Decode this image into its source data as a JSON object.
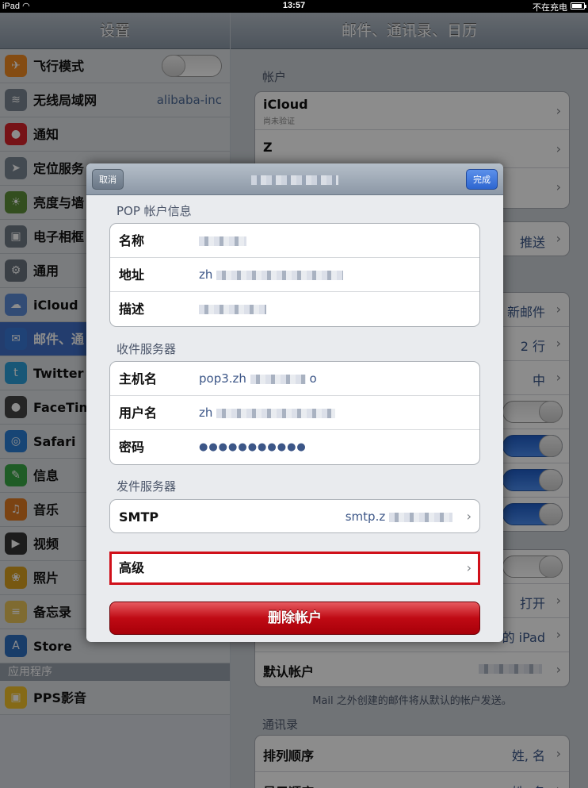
{
  "status_bar": {
    "device": "iPad",
    "time": "13:57",
    "charging": "不在充电"
  },
  "left_pane": {
    "title": "设置",
    "items": [
      {
        "label": "飞行模式",
        "icon": "airplane-icon",
        "toggle": "off"
      },
      {
        "label": "无线局域网",
        "value": "alibaba-inc",
        "icon": "wifi-icon"
      },
      {
        "label": "通知",
        "icon": "notification-icon"
      },
      {
        "label": "定位服务",
        "icon": "location-icon"
      },
      {
        "label": "亮度与墙",
        "icon": "brightness-icon"
      },
      {
        "label": "电子相框",
        "icon": "picture-frame-icon"
      },
      {
        "label": "通用",
        "icon": "gear-icon"
      },
      {
        "label": "iCloud",
        "icon": "cloud-icon"
      },
      {
        "label": "邮件、通",
        "icon": "mail-icon",
        "selected": true
      },
      {
        "label": "Twitter",
        "icon": "twitter-icon"
      },
      {
        "label": "FaceTim",
        "icon": "facetime-icon"
      },
      {
        "label": "Safari",
        "icon": "safari-icon"
      },
      {
        "label": "信息",
        "icon": "messages-icon"
      },
      {
        "label": "音乐",
        "icon": "music-icon"
      },
      {
        "label": "视频",
        "icon": "video-icon"
      },
      {
        "label": "照片",
        "icon": "photos-icon"
      },
      {
        "label": "备忘录",
        "icon": "notes-icon"
      },
      {
        "label": "Store",
        "icon": "store-icon"
      }
    ],
    "section_apps": "应用程序",
    "apps": [
      {
        "label": "PPS影音",
        "icon": "pps-icon"
      }
    ]
  },
  "right_pane": {
    "title": "邮件、通讯录、日历",
    "accounts_header": "帐户",
    "accounts": [
      {
        "name": "iCloud",
        "sub": "尚未验证"
      },
      {
        "name": "Z"
      },
      {
        "name": ""
      }
    ],
    "push_value": "推送",
    "new_mail_value": "新邮件",
    "preview_value": "2 行",
    "font_size_value": "中",
    "show_value": "打开",
    "signature_value": "的 iPad",
    "default_account_label": "默认帐户",
    "default_account_note": "Mail 之外创建的邮件将从默认的帐户发送。",
    "contacts_header": "通讯录",
    "sort_order_label": "排列顺序",
    "sort_order_value": "姓, 名",
    "display_order_label": "显示顺序",
    "display_order_value": "姓, 名"
  },
  "modal": {
    "cancel_label": "取消",
    "done_label": "完成",
    "pop_header": "POP 帐户信息",
    "name_label": "名称",
    "address_label": "地址",
    "address_value": "zh",
    "description_label": "描述",
    "incoming_header": "收件服务器",
    "host_label": "主机名",
    "host_value": "pop3.zh",
    "host_suffix": "o",
    "username_label": "用户名",
    "username_value": "zh",
    "password_label": "密码",
    "password_value": "●●●●●●●●●●●",
    "outgoing_header": "发件服务器",
    "smtp_label": "SMTP",
    "smtp_value": "smtp.z",
    "advanced_label": "高级",
    "delete_label": "删除帐户"
  }
}
